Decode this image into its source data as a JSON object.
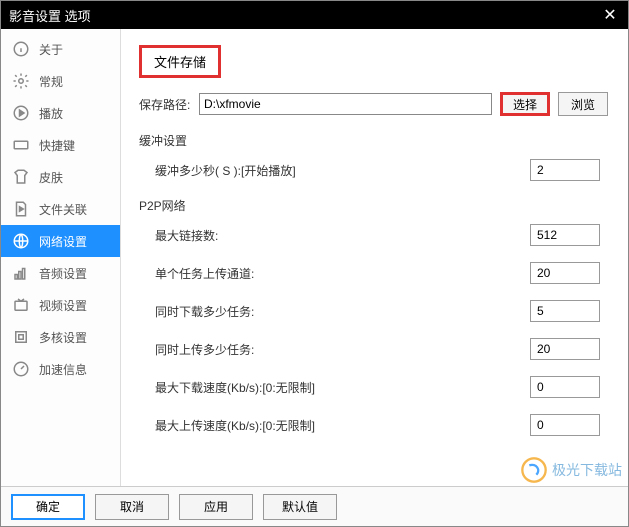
{
  "window": {
    "title": "影音设置 选项"
  },
  "sidebar": {
    "items": [
      {
        "label": "关于"
      },
      {
        "label": "常规"
      },
      {
        "label": "播放"
      },
      {
        "label": "快捷键"
      },
      {
        "label": "皮肤"
      },
      {
        "label": "文件关联"
      },
      {
        "label": "网络设置"
      },
      {
        "label": "音频设置"
      },
      {
        "label": "视频设置"
      },
      {
        "label": "多核设置"
      },
      {
        "label": "加速信息"
      }
    ]
  },
  "content": {
    "file_storage_header": "文件存储",
    "save_path_label": "保存路径:",
    "save_path_value": "D:\\xfmovie",
    "select_btn": "选择",
    "browse_btn": "浏览",
    "buffer_section": "缓冲设置",
    "buffer_label": "缓冲多少秒( S ):[开始播放]",
    "buffer_value": "2",
    "p2p_section": "P2P网络",
    "max_conn_label": "最大链接数:",
    "max_conn_value": "512",
    "single_upload_label": "单个任务上传通道:",
    "single_upload_value": "20",
    "concurrent_dl_label": "同时下载多少任务:",
    "concurrent_dl_value": "5",
    "concurrent_ul_label": "同时上传多少任务:",
    "concurrent_ul_value": "20",
    "max_dl_speed_label": "最大下载速度(Kb/s):[0:无限制]",
    "max_dl_speed_value": "0",
    "max_ul_speed_label": "最大上传速度(Kb/s):[0:无限制]",
    "max_ul_speed_value": "0"
  },
  "footer": {
    "ok": "确定",
    "cancel": "取消",
    "apply": "应用",
    "default": "默认值"
  },
  "watermark": {
    "text": "极光下载站"
  }
}
